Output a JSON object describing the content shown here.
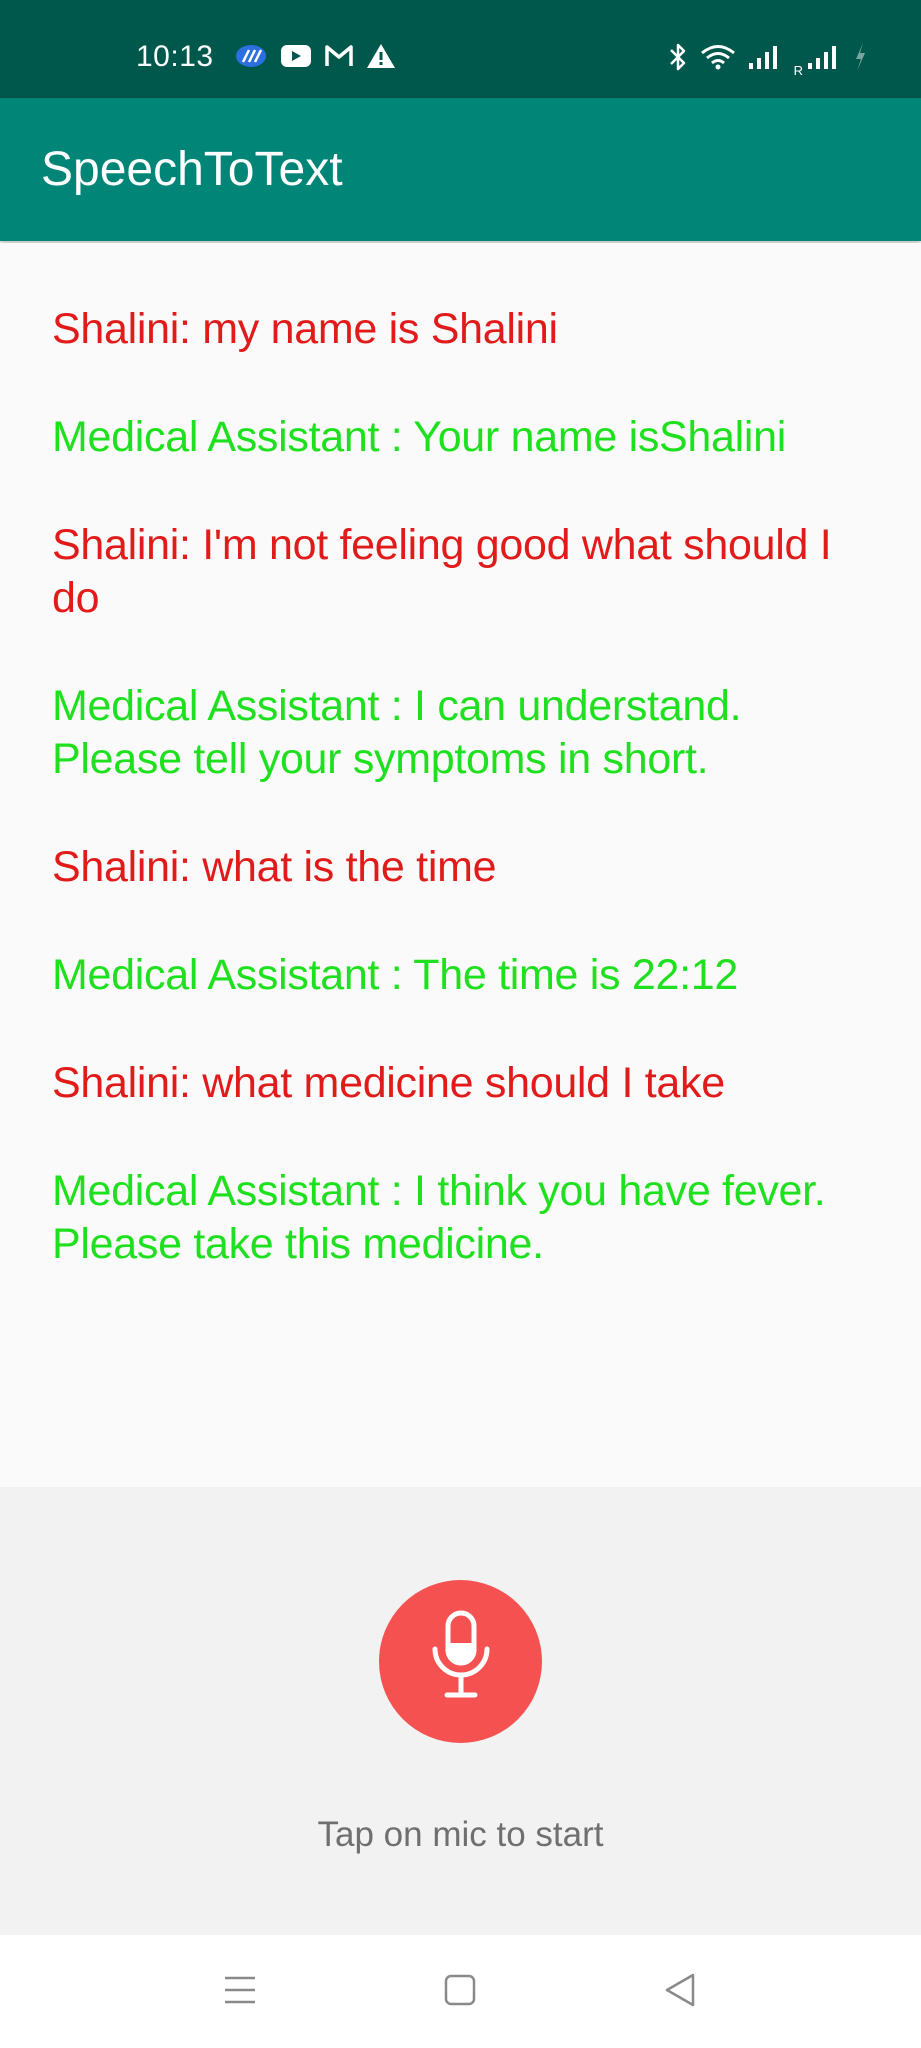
{
  "status_bar": {
    "time": "10:13",
    "left_icons": [
      "cloud-sync-icon",
      "youtube-icon",
      "gmail-icon",
      "warning-icon"
    ],
    "right_icons": [
      "bluetooth-icon",
      "wifi-icon",
      "signal-icon",
      "roaming-signal-icon",
      "battery-charging-icon"
    ],
    "roaming_label": "R"
  },
  "app_bar": {
    "title": "SpeechToText"
  },
  "messages": [
    {
      "role": "user",
      "text": "Shalini: my name is Shalini"
    },
    {
      "role": "bot",
      "text": "Medical Assistant : Your name isShalini"
    },
    {
      "role": "user",
      "text": "Shalini: I'm not feeling good what should I do"
    },
    {
      "role": "bot",
      "text": "Medical Assistant : I can understand. Please tell your symptoms in short."
    },
    {
      "role": "user",
      "text": "Shalini: what is the time"
    },
    {
      "role": "bot",
      "text": "Medical Assistant : The time is 22:12"
    },
    {
      "role": "user",
      "text": "Shalini: what medicine should I take"
    },
    {
      "role": "bot",
      "text": "Medical Assistant : I think you have fever. Please take this medicine."
    }
  ],
  "mic": {
    "icon": "microphone-icon",
    "hint": "Tap on mic to start"
  },
  "nav_bar": {
    "icons": [
      "menu-icon",
      "home-icon",
      "back-icon"
    ]
  },
  "colors": {
    "status_bar": "#00574b",
    "app_bar": "#008577",
    "user_text": "#e11a1a",
    "bot_text": "#1fe01f",
    "mic_button": "#f55151"
  }
}
